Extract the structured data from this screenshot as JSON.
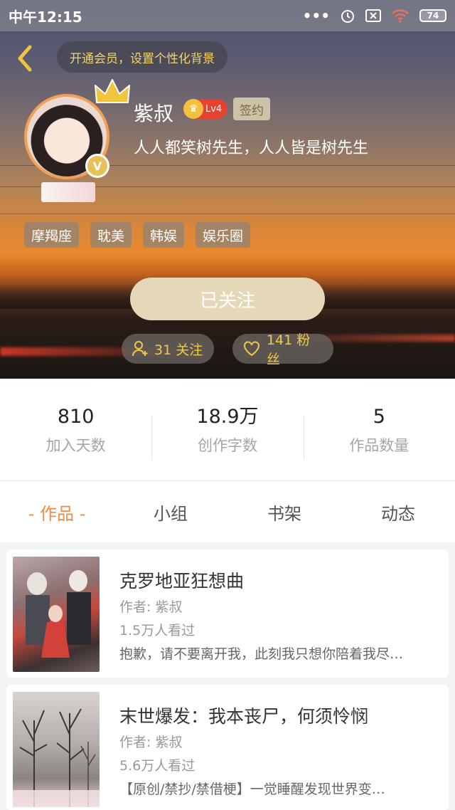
{
  "status_bar": {
    "time": "中午12:15",
    "battery": "74"
  },
  "header": {
    "vip_banner": "开通会员，设置个性化背景"
  },
  "profile": {
    "name": "紫叔",
    "level": "Lv4",
    "sign_badge": "签约",
    "bio": "人人都笑树先生，人人皆是树先生",
    "verified_badge": "V",
    "tags": [
      "摩羯座",
      "耽美",
      "韩娱",
      "娱乐圈"
    ],
    "follow_button": "已关注",
    "following": "31 关注",
    "fans": "141 粉丝"
  },
  "stats": [
    {
      "value": "810",
      "label": "加入天数"
    },
    {
      "value": "18.9万",
      "label": "创作字数"
    },
    {
      "value": "5",
      "label": "作品数量"
    }
  ],
  "tabs": [
    {
      "label": "- 作品 -",
      "active": true
    },
    {
      "label": "小组",
      "active": false
    },
    {
      "label": "书架",
      "active": false
    },
    {
      "label": "动态",
      "active": false
    }
  ],
  "works": [
    {
      "title": "克罗地亚狂想曲",
      "author": "作者: 紫叔",
      "views": "1.5万人看过",
      "description": "抱歉，请不要离开我，此刻我只想你陪着我尽…"
    },
    {
      "title": "末世爆发：我本丧尸，何须怜悯",
      "author": "作者: 紫叔",
      "views": "5.6万人看过",
      "description": "【原创/禁抄/禁借梗】一觉睡醒发现世界变…"
    }
  ],
  "colors": {
    "accent": "#ef8a48",
    "gold": "#f0c949",
    "level_badge": "#e5432f"
  }
}
